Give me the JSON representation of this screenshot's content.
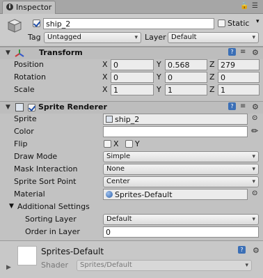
{
  "window": {
    "tab_title": "Inspector",
    "tab_icon": "i",
    "tab_controls": "☰≡"
  },
  "gameobject": {
    "active": true,
    "name": "ship_2",
    "static_label": "Static",
    "static_checked": false,
    "tag_label": "Tag",
    "tag_value": "Untagged",
    "layer_label": "Layer",
    "layer_value": "Default"
  },
  "transform": {
    "title": "Transform",
    "rows": [
      {
        "label": "Position",
        "x": "0",
        "y": "0.568",
        "z": "279"
      },
      {
        "label": "Rotation",
        "x": "0",
        "y": "0",
        "z": "0"
      },
      {
        "label": "Scale",
        "x": "1",
        "y": "1",
        "z": "1"
      }
    ],
    "axis": {
      "x": "X",
      "y": "Y",
      "z": "Z"
    }
  },
  "sprite_renderer": {
    "title": "Sprite Renderer",
    "enabled": true,
    "sprite_label": "Sprite",
    "sprite_value": "ship_2",
    "color_label": "Color",
    "color_value": "#ffffff",
    "flip_label": "Flip",
    "flip_x": "X",
    "flip_y": "Y",
    "draw_mode_label": "Draw Mode",
    "draw_mode_value": "Simple",
    "mask_label": "Mask Interaction",
    "mask_value": "None",
    "sort_point_label": "Sprite Sort Point",
    "sort_point_value": "Center",
    "material_label": "Material",
    "material_value": "Sprites-Default",
    "additional_label": "Additional Settings",
    "sorting_layer_label": "Sorting Layer",
    "sorting_layer_value": "Default",
    "order_label": "Order in Layer",
    "order_value": "0"
  },
  "material": {
    "name": "Sprites-Default",
    "shader_label": "Shader",
    "shader_value": "Sprites/Default"
  },
  "colors": {
    "accent": "#3b6fb6",
    "panel": "#c2c2c2"
  }
}
